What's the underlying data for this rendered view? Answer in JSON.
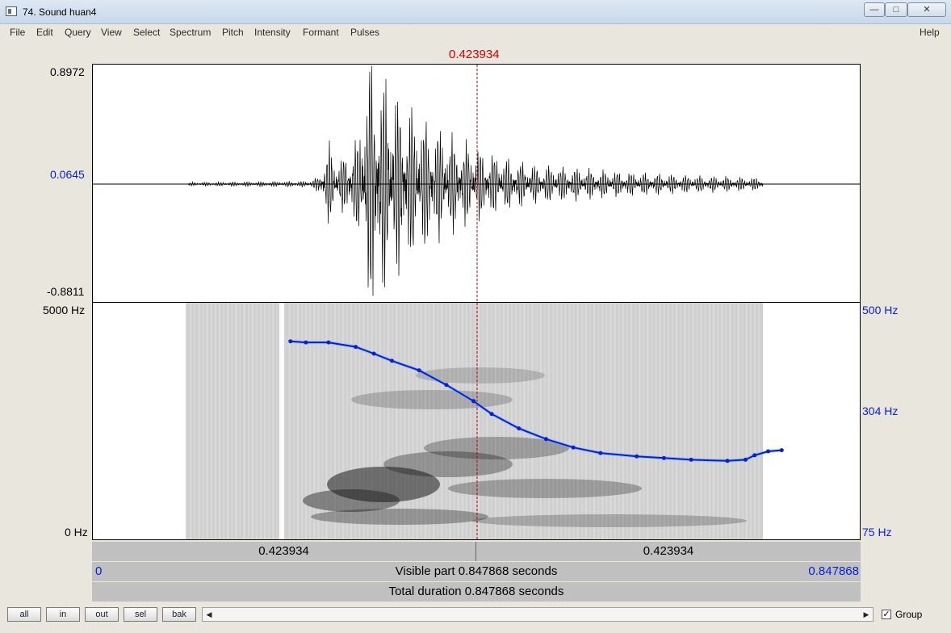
{
  "window": {
    "title": "74. Sound huan4"
  },
  "menu": [
    "File",
    "Edit",
    "Query",
    "View",
    "Select",
    "Spectrum",
    "Pitch",
    "Intensity",
    "Formant",
    "Pulses"
  ],
  "help": "Help",
  "cursor_time": "0.423934",
  "waveform": {
    "max": "0.8972",
    "mid": "0.0645",
    "min": "-0.8811"
  },
  "spectrogram": {
    "top": "5000 Hz",
    "bottom": "0 Hz"
  },
  "pitch_axis": {
    "top": "500 Hz",
    "mid": "304 Hz",
    "bottom": "75 Hz"
  },
  "selection": {
    "left": "0.423934",
    "right": "0.423934"
  },
  "visible": {
    "start": "0",
    "text": "Visible part 0.847868 seconds",
    "end": "0.847868"
  },
  "total": {
    "text": "Total duration 0.847868 seconds"
  },
  "buttons": {
    "all": "all",
    "in": "in",
    "out": "out",
    "sel": "sel",
    "bak": "bak"
  },
  "group_label": "Group",
  "colors": {
    "cursor": "#cc0000",
    "pitch": "#0a1fd1",
    "wave": "#000000"
  },
  "chart_data": {
    "type": "line",
    "xlabel": "",
    "ylabel": "",
    "xlim": [
      0,
      0.847868
    ],
    "ylim": [
      75,
      500
    ],
    "series": [
      {
        "x": [
          0.218,
          0.235,
          0.26,
          0.29,
          0.31,
          0.33,
          0.36,
          0.39,
          0.42,
          0.44,
          0.47,
          0.5,
          0.53,
          0.56,
          0.6,
          0.63,
          0.66,
          0.7,
          0.72,
          0.73,
          0.745,
          0.76
        ],
        "y": [
          431,
          429,
          429,
          421,
          409,
          396,
          379,
          353,
          324,
          301,
          275,
          256,
          241,
          231,
          225,
          222,
          219,
          217,
          219,
          227,
          234,
          236
        ]
      }
    ]
  }
}
